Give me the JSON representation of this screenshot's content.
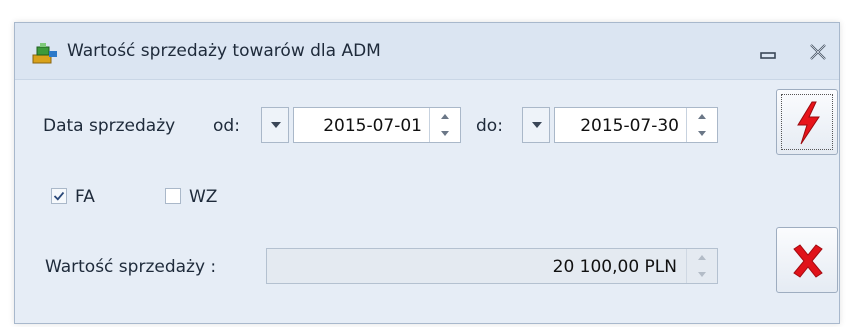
{
  "window": {
    "title": "Wartość sprzedaży towarów dla ADM",
    "icons": {
      "app": "cash-register-icon",
      "minimize": "minimize-icon",
      "close": "close-icon"
    }
  },
  "form": {
    "date_label": "Data sprzedaży",
    "from_label": "od:",
    "from_value": "2015-07-01",
    "to_label": "do:",
    "to_value": "2015-07-30",
    "checkboxes": [
      {
        "label": "FA",
        "checked": true
      },
      {
        "label": "WZ",
        "checked": false
      }
    ],
    "value_label": "Wartość sprzedaży :",
    "value": "20 100,00 PLN"
  },
  "actions": {
    "calculate_icon": "lightning-icon",
    "cancel_icon": "red-x-icon"
  },
  "colors": {
    "window_bg": "#e6edf6",
    "titlebar_bg": "#dbe5f2",
    "border": "#aab8c9",
    "lightning_red": "#e8141a",
    "cancel_red": "#e0121a"
  }
}
